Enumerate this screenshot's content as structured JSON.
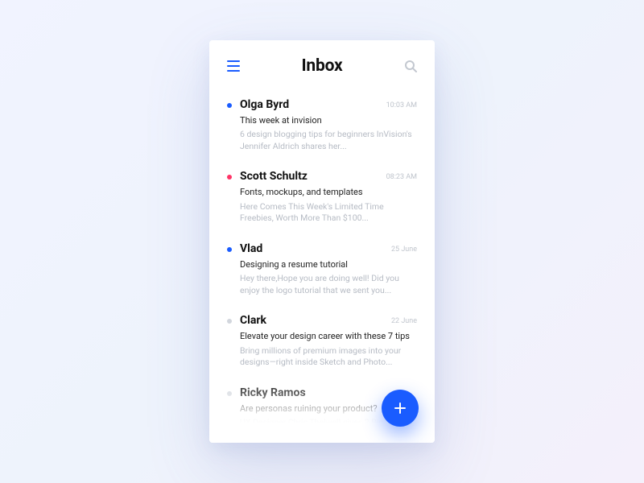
{
  "header": {
    "title": "Inbox"
  },
  "colors": {
    "accent": "#1a5cff",
    "dot_blue": "#1a5cff",
    "dot_pink": "#ff3366",
    "dot_grey": "#d2d6dd"
  },
  "emails": [
    {
      "sender": "Olga Byrd",
      "time": "10:03 AM",
      "subject": "This week at invision",
      "preview": "6 design blogging tips for beginners InVision's Jennifer Aldrich shares her...",
      "dot": "#1a5cff"
    },
    {
      "sender": "Scott Schultz",
      "time": "08:23 AM",
      "subject": "Fonts, mockups, and templates",
      "preview": "Here Comes This Week's Limited Time Freebies, Worth More Than $100...",
      "dot": "#ff3366"
    },
    {
      "sender": "Vlad",
      "time": "25 June",
      "subject": "Designing a resume tutorial",
      "preview": "Hey there,Hope you are doing well! Did you enjoy the logo tutorial that we sent you...",
      "dot": "#1a5cff"
    },
    {
      "sender": "Clark",
      "time": "22 June",
      "subject": "Elevate your design career with these 7 tips",
      "preview": "Bring millions of premium images into your designs—right inside Sketch and Photo...",
      "dot": "#d2d6dd"
    },
    {
      "sender": "Ricky Ramos",
      "time": "",
      "subject": "Are personas ruining your product?",
      "preview": "UX Designer Chris Thelwell gives 2 Big...",
      "dot": "#d2d6dd"
    }
  ]
}
